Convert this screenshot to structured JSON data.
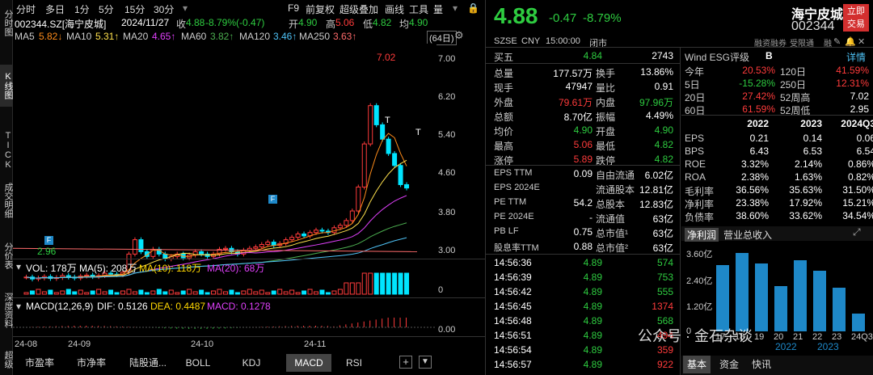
{
  "left_tabs": [
    "分时图",
    "K线图",
    "TICK",
    "成交明细",
    "分价表",
    "深度资料",
    "超级"
  ],
  "toolbar": {
    "items": [
      "分时",
      "多日",
      "1分",
      "5分",
      "15分",
      "30分"
    ],
    "f9": "F9",
    "items2": [
      "前复权",
      "超级叠加",
      "画线",
      "工具",
      "量"
    ]
  },
  "header": {
    "code": "002344.SZ[海宁皮城]",
    "date": "2024/11/27",
    "close_l": "收",
    "close": "4.88",
    "chg": "-8.79%(-0.47)",
    "open_l": "开",
    "open": "4.90",
    "high_l": "高",
    "high": "5.06",
    "low_l": "低",
    "low": "4.82",
    "avg_l": "均",
    "avg": "4.90"
  },
  "ma": {
    "ma5": "MA5",
    "v5": "5.82↓",
    "ma10": "MA10",
    "v10": "5.31↑",
    "ma20": "MA20",
    "v20": "4.65↑",
    "ma60": "MA60",
    "v60": "3.82↑",
    "ma120": "MA120",
    "v120": "3.46↑",
    "ma250": "MA250",
    "v250": "3.63↑",
    "period": "(64日)"
  },
  "price_axis": [
    "7.00",
    "6.20",
    "5.40",
    "4.60",
    "3.80",
    "3.00"
  ],
  "markers": {
    "high": "7.02",
    "low": "2.96",
    "t1": "T",
    "t2": "T",
    "f1": "F",
    "f2": "F"
  },
  "vol": {
    "label": "VOL: 178万",
    "ma5": "MA(5): 208万",
    "ma10": "MA(10): 118万",
    "ma20": "MA(20): 68万",
    "axis": "0"
  },
  "macd": {
    "label": "MACD(12,26,9)",
    "dif": "DIF: 0.5126",
    "dea": "DEA: 0.4487",
    "val": "MACD: 0.1278",
    "axis": "0.00"
  },
  "xaxis": [
    "24-08",
    "24-09",
    "24-10",
    "24-11"
  ],
  "bottom_tabs": [
    "市盈率",
    "市净率",
    "陆股通...",
    "BOLL",
    "KDJ",
    "MACD",
    "RSI"
  ],
  "quote": {
    "price": "4.88",
    "chg": "-0.47",
    "pct": "-8.79%",
    "name": "海宁皮城",
    "code": "002344",
    "btn": "立即交易",
    "exch": "SZSE",
    "cur": "CNY",
    "time": "15:00:00",
    "status": "闭市",
    "tags": "融资融券",
    "tags2": "受限通",
    "tags3": "融",
    "tags4": "关"
  },
  "sell5": {
    "label": "买五",
    "price": "4.84",
    "vol": "2743"
  },
  "stats": [
    [
      "总量",
      "177.57万",
      "换手",
      "13.86%"
    ],
    [
      "现手",
      "47947",
      "量比",
      "0.91"
    ],
    [
      "外盘",
      "79.61万",
      "内盘",
      "97.96万"
    ],
    [
      "总额",
      "8.70亿",
      "振幅",
      "4.49%"
    ],
    [
      "均价",
      "4.90",
      "开盘",
      "4.90"
    ],
    [
      "最高",
      "5.06",
      "最低",
      "4.82"
    ],
    [
      "涨停",
      "5.89",
      "跌停",
      "4.82"
    ]
  ],
  "fund": [
    [
      "EPS TTM",
      "0.09",
      "自由流通",
      "6.02亿"
    ],
    [
      "EPS 2024E",
      "",
      "流通股本",
      "12.81亿"
    ],
    [
      "PE TTM",
      "54.2",
      "总股本",
      "12.83亿"
    ],
    [
      "PE 2024E",
      "-",
      "流通值",
      "63亿"
    ],
    [
      "PB LF",
      "0.75",
      "总市值¹",
      "63亿"
    ],
    [
      "股息率TTM",
      "0.88",
      "总市值²",
      "63亿"
    ]
  ],
  "ticks": [
    [
      "14:56:36",
      "4.89",
      "574"
    ],
    [
      "14:56:39",
      "4.89",
      "753"
    ],
    [
      "14:56:42",
      "4.89",
      "555"
    ],
    [
      "14:56:45",
      "4.89",
      "1374"
    ],
    [
      "14:56:48",
      "4.89",
      "568"
    ],
    [
      "14:56:51",
      "4.89",
      "494"
    ],
    [
      "14:56:54",
      "4.89",
      "359"
    ],
    [
      "14:56:57",
      "4.89",
      "922"
    ],
    [
      "14:57:00",
      "4.89",
      "1000"
    ]
  ],
  "esg": {
    "label": "Wind ESG评级",
    "grade": "B",
    "detail": "详情"
  },
  "perf": [
    [
      "今年",
      "20.53%",
      "120日",
      "41.59%"
    ],
    [
      "5日",
      "-15.28%",
      "250日",
      "12.31%"
    ],
    [
      "20日",
      "27.42%",
      "52周高",
      "7.02"
    ],
    [
      "60日",
      "61.59%",
      "52周低",
      "2.95"
    ]
  ],
  "fin": {
    "years": [
      "2022",
      "2023",
      "2024Q3"
    ],
    "rows": [
      [
        "EPS",
        "0.21",
        "0.14",
        "0.06"
      ],
      [
        "BPS",
        "6.43",
        "6.53",
        "6.54"
      ],
      [
        "ROE",
        "3.32%",
        "2.14%",
        "0.86%"
      ],
      [
        "ROA",
        "2.38%",
        "1.63%",
        "0.82%"
      ],
      [
        "毛利率",
        "36.56%",
        "35.63%",
        "31.50%"
      ],
      [
        "净利率",
        "23.38%",
        "17.92%",
        "15.21%"
      ],
      [
        "负债率",
        "38.60%",
        "33.62%",
        "34.54%"
      ]
    ]
  },
  "rev_tabs": [
    "净利润",
    "营业总收入"
  ],
  "chart_data": {
    "type": "bar",
    "title": "",
    "categories": [
      "17",
      "18",
      "19",
      "20",
      "21",
      "22",
      "23",
      "24Q3"
    ],
    "values": [
      3.0,
      3.55,
      3.1,
      2.05,
      3.25,
      2.75,
      2.0,
      0.8
    ],
    "yticks": [
      "3.60亿",
      "2.40亿",
      "1.20亿",
      "0"
    ],
    "ylim": [
      0,
      3.6
    ]
  },
  "rev_foot": {
    "y1": "2022",
    "y2": "2023"
  },
  "bottom_right": [
    "基本",
    "资金",
    "快讯"
  ],
  "watermark": "公众号 · 金石杂谈"
}
